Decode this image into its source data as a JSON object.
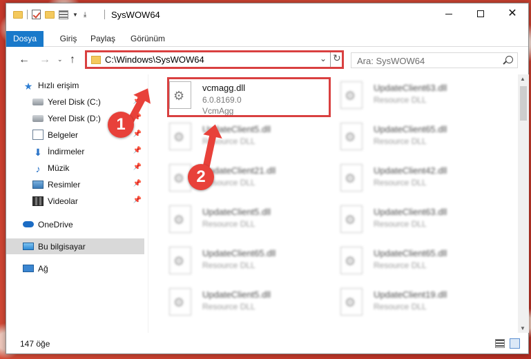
{
  "window": {
    "title": "SysWOW64"
  },
  "ribbon": {
    "tabs": [
      {
        "label": "Dosya"
      },
      {
        "label": "Giriş"
      },
      {
        "label": "Paylaş"
      },
      {
        "label": "Görünüm"
      }
    ]
  },
  "address": {
    "path": "C:\\Windows\\SysWOW64"
  },
  "search": {
    "placeholder": "Ara: SysWOW64"
  },
  "sidebar": {
    "items": [
      {
        "label": "Hızlı erişim",
        "icon": "star-icon"
      },
      {
        "label": "Yerel Disk (C:)",
        "icon": "disk-icon",
        "pinned": true
      },
      {
        "label": "Yerel Disk (D:)",
        "icon": "disk-icon",
        "pinned": true
      },
      {
        "label": "Belgeler",
        "icon": "documents-icon",
        "pinned": true
      },
      {
        "label": "İndirmeler",
        "icon": "download-icon",
        "pinned": true
      },
      {
        "label": "Müzik",
        "icon": "music-icon",
        "pinned": true
      },
      {
        "label": "Resimler",
        "icon": "pictures-icon",
        "pinned": true
      },
      {
        "label": "Videolar",
        "icon": "videos-icon",
        "pinned": true
      },
      {
        "label": "OneDrive",
        "icon": "cloud-icon"
      },
      {
        "label": "Bu bilgisayar",
        "icon": "computer-icon",
        "selected": true
      },
      {
        "label": "Ağ",
        "icon": "network-icon"
      }
    ]
  },
  "files": [
    {
      "name": "vcmagg.dll",
      "line2": "6.0.8169.0",
      "line3": "VcmAgg"
    },
    {
      "name": "UpdateClient63.dll",
      "line2": "Resource DLL"
    },
    {
      "name": "UpdateClient5.dll",
      "line2": "Resource DLL"
    },
    {
      "name": "UpdateClient65.dll",
      "line2": "Resource DLL"
    },
    {
      "name": "UpdateClient21.dll",
      "line2": "Resource DLL"
    },
    {
      "name": "UpdateClient42.dll",
      "line2": "Resource DLL"
    },
    {
      "name": "UpdateClient5.dll",
      "line2": "Resource DLL"
    },
    {
      "name": "UpdateClient63.dll",
      "line2": "Resource DLL"
    },
    {
      "name": "UpdateClient65.dll",
      "line2": "Resource DLL"
    },
    {
      "name": "UpdateClient65.dll",
      "line2": "Resource DLL"
    },
    {
      "name": "UpdateClient5.dll",
      "line2": "Resource DLL"
    },
    {
      "name": "UpdateClient19.dll",
      "line2": "Resource DLL"
    }
  ],
  "status": {
    "count": "147 öğe"
  },
  "callouts": [
    "1",
    "2"
  ],
  "colors": {
    "accent": "#1979ca",
    "highlight": "#d94040",
    "callout": "#e8413a"
  }
}
